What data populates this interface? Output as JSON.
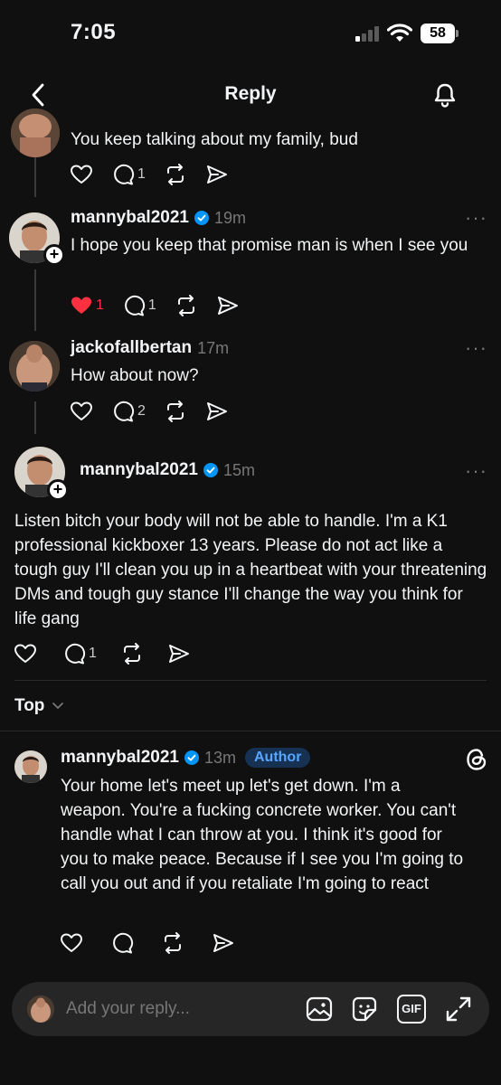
{
  "status": {
    "time": "7:05",
    "battery": "58"
  },
  "nav": {
    "title": "Reply"
  },
  "posts": [
    {
      "text": "You keep talking about my family, bud",
      "reply_count": "1"
    },
    {
      "username": "mannybal2021",
      "time": "19m",
      "text": "I hope you keep that promise man is when I see you",
      "like_count": "1",
      "reply_count": "1"
    },
    {
      "username": "jackofallbertan",
      "time": "17m",
      "text": "How about now?",
      "reply_count": "2"
    },
    {
      "username": "mannybal2021",
      "time": "15m",
      "text": "Listen bitch your body will not be able to handle. I'm a K1 professional kickboxer 13 years. Please do not act like a tough guy I'll clean you up in a heartbeat with your threatening DMs and tough guy stance I'll change the way you think for life gang",
      "reply_count": "1"
    }
  ],
  "sort": {
    "label": "Top"
  },
  "reply": {
    "username": "mannybal2021",
    "time": "13m",
    "badge": "Author",
    "text": "Your home let's meet up let's get down. I'm a weapon. You're a fucking concrete worker. You can't handle what I can throw at you. I think it's good for you to make peace. Because if I see you I'm going to call you out and if you retaliate I'm going to react"
  },
  "composer": {
    "placeholder": "Add your reply...",
    "gif_label": "GIF"
  },
  "colors": {
    "background": "#101010",
    "verified": "#0095f6",
    "liked": "#ff3040",
    "author_badge": "#58a6ff"
  }
}
